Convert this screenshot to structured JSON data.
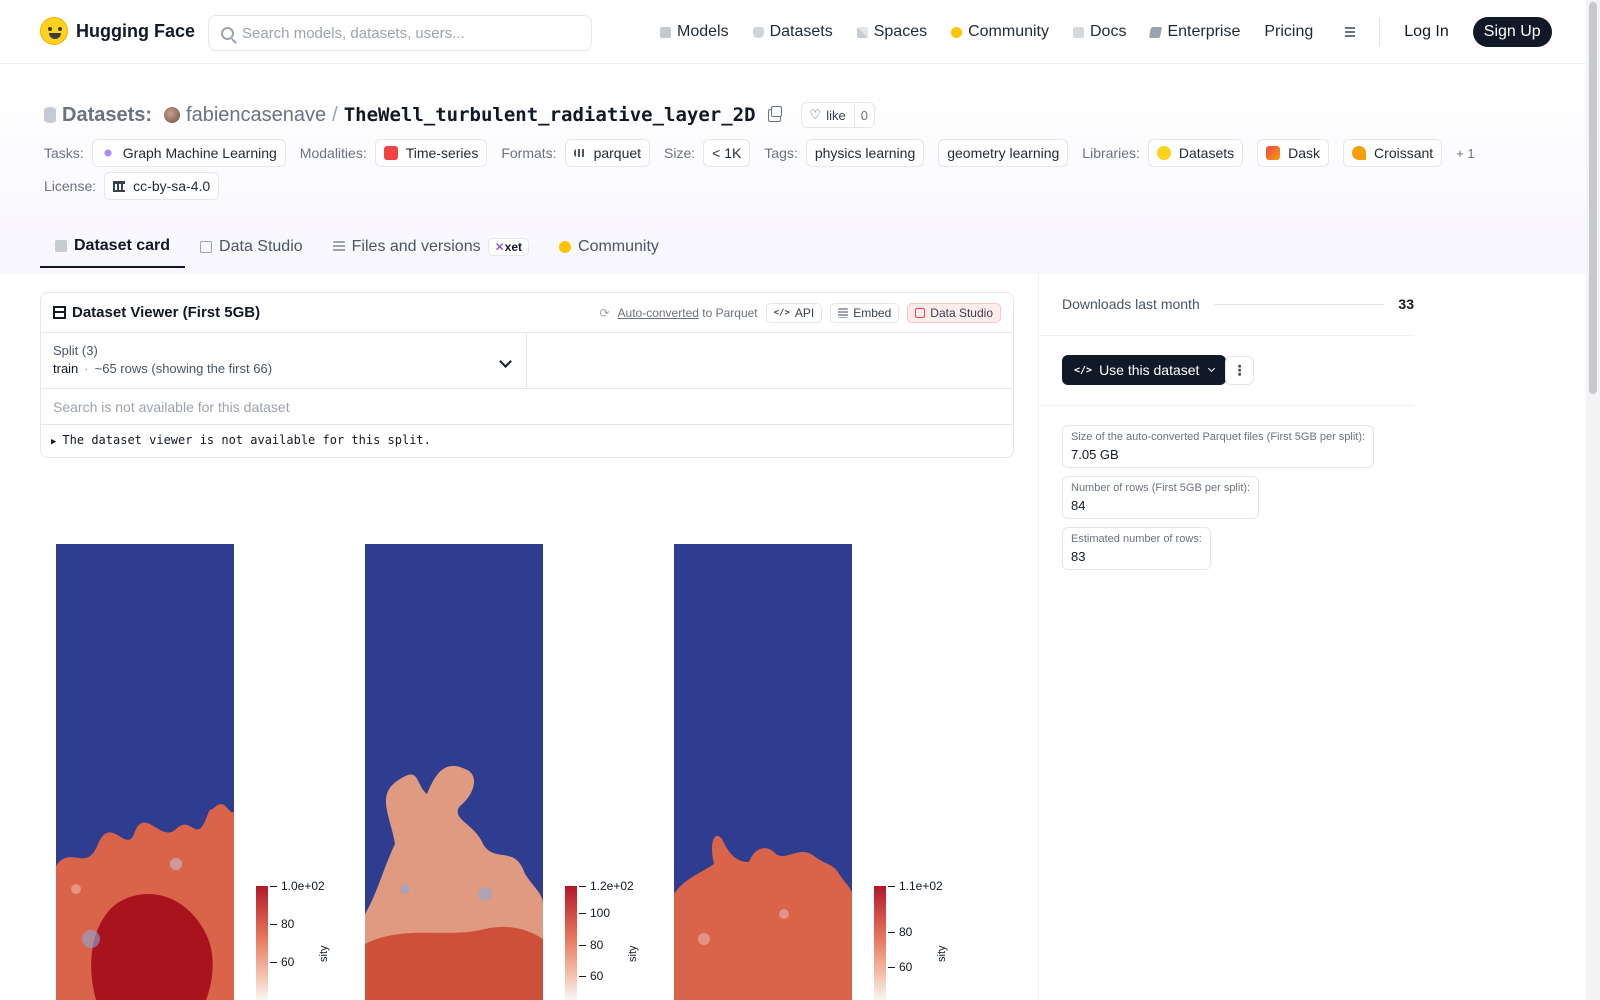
{
  "nav": {
    "brand": "Hugging Face",
    "search_placeholder": "Search models, datasets, users...",
    "links": [
      "Models",
      "Datasets",
      "Spaces",
      "Community",
      "Docs",
      "Enterprise",
      "Pricing"
    ],
    "login": "Log In",
    "signup": "Sign Up"
  },
  "header": {
    "section": "Datasets:",
    "owner": "fabiencasenave",
    "slash": "/",
    "name": "TheWell_turbulent_radiative_layer_2D",
    "like_label": "like",
    "like_count": "0",
    "tasks_label": "Tasks:",
    "task": "Graph Machine Learning",
    "modalities_label": "Modalities:",
    "modality": "Time-series",
    "formats_label": "Formats:",
    "format": "parquet",
    "size_label": "Size:",
    "size": "< 1K",
    "tags_label": "Tags:",
    "tags": [
      "physics learning",
      "geometry learning"
    ],
    "libraries_label": "Libraries:",
    "libraries": [
      "Datasets",
      "Dask",
      "Croissant"
    ],
    "libraries_more": "+ 1",
    "license_label": "License:",
    "license": "cc-by-sa-4.0"
  },
  "tabs": {
    "card": "Dataset card",
    "studio": "Data Studio",
    "files": "Files and versions",
    "xet": "xet",
    "community": "Community"
  },
  "viewer": {
    "title": "Dataset Viewer (First 5GB)",
    "auto_converted": "Auto-converted",
    "to_parquet": "to Parquet",
    "api": "API",
    "embed": "Embed",
    "data_studio": "Data Studio",
    "split_label": "Split (3)",
    "split_value": "train",
    "split_rows": "~65 rows (showing the first 66)",
    "search_placeholder": "Search is not available for this dataset",
    "notice": "The dataset viewer is not available for this split."
  },
  "images": {
    "panel1": {
      "max": "1.0e+02",
      "ticks": [
        "80",
        "60"
      ]
    },
    "panel2": {
      "max": "1.2e+02",
      "ticks": [
        "100",
        "80",
        "60"
      ]
    },
    "panel3": {
      "max": "1.1e+02",
      "ticks": [
        "80",
        "60"
      ]
    },
    "colorbar_label": "sity"
  },
  "sidebar": {
    "downloads_label": "Downloads last month",
    "downloads": "33",
    "use_button": "Use this dataset",
    "stats": [
      {
        "label": "Size of the auto-converted Parquet files (First 5GB per split):",
        "value": "7.05 GB"
      },
      {
        "label": "Number of rows (First 5GB per split):",
        "value": "84"
      },
      {
        "label": "Estimated number of rows:",
        "value": "83"
      }
    ]
  }
}
